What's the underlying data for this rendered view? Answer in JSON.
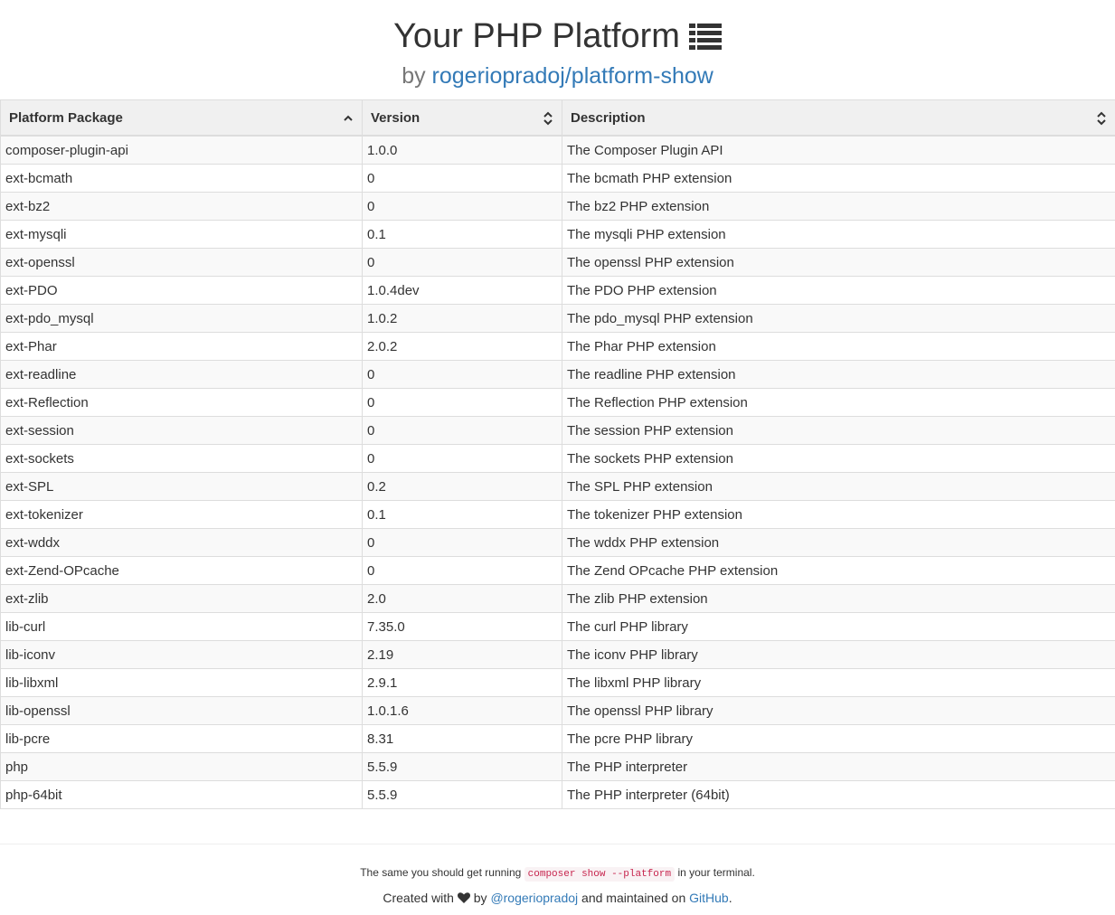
{
  "header": {
    "title": "Your PHP Platform",
    "by_text": "by",
    "repo_link": "rogeriopradoj/platform-show"
  },
  "table": {
    "columns": [
      "Platform Package",
      "Version",
      "Description"
    ],
    "rows": [
      [
        "composer-plugin-api",
        "1.0.0",
        "The Composer Plugin API"
      ],
      [
        "ext-bcmath",
        "0",
        "The bcmath PHP extension"
      ],
      [
        "ext-bz2",
        "0",
        "The bz2 PHP extension"
      ],
      [
        "ext-mysqli",
        "0.1",
        "The mysqli PHP extension"
      ],
      [
        "ext-openssl",
        "0",
        "The openssl PHP extension"
      ],
      [
        "ext-PDO",
        "1.0.4dev",
        "The PDO PHP extension"
      ],
      [
        "ext-pdo_mysql",
        "1.0.2",
        "The pdo_mysql PHP extension"
      ],
      [
        "ext-Phar",
        "2.0.2",
        "The Phar PHP extension"
      ],
      [
        "ext-readline",
        "0",
        "The readline PHP extension"
      ],
      [
        "ext-Reflection",
        "0",
        "The Reflection PHP extension"
      ],
      [
        "ext-session",
        "0",
        "The session PHP extension"
      ],
      [
        "ext-sockets",
        "0",
        "The sockets PHP extension"
      ],
      [
        "ext-SPL",
        "0.2",
        "The SPL PHP extension"
      ],
      [
        "ext-tokenizer",
        "0.1",
        "The tokenizer PHP extension"
      ],
      [
        "ext-wddx",
        "0",
        "The wddx PHP extension"
      ],
      [
        "ext-Zend-OPcache",
        "0",
        "The Zend OPcache PHP extension"
      ],
      [
        "ext-zlib",
        "2.0",
        "The zlib PHP extension"
      ],
      [
        "lib-curl",
        "7.35.0",
        "The curl PHP library"
      ],
      [
        "lib-iconv",
        "2.19",
        "The iconv PHP library"
      ],
      [
        "lib-libxml",
        "2.9.1",
        "The libxml PHP library"
      ],
      [
        "lib-openssl",
        "1.0.1.6",
        "The openssl PHP library"
      ],
      [
        "lib-pcre",
        "8.31",
        "The pcre PHP library"
      ],
      [
        "php",
        "5.5.9",
        "The PHP interpreter"
      ],
      [
        "php-64bit",
        "5.5.9",
        "The PHP interpreter (64bit)"
      ]
    ]
  },
  "footer": {
    "line1_before": "The same you should get running",
    "command": "composer show --platform",
    "line1_after": "in your terminal.",
    "created_with": "Created with",
    "by": "by",
    "author_link": "@rogeriopradoj",
    "maintained": "and maintained on",
    "github_link": "GitHub",
    "period": "."
  },
  "icons": {
    "title_icon": "list-icon",
    "sort_asc": "sort-up-icon",
    "sort_both": "sort-icon",
    "heart": "heart-icon"
  },
  "colors": {
    "link": "#337ab7",
    "header_bg": "#f0f0f0",
    "stripe": "#f9f9f9",
    "code": "#c7254e"
  }
}
